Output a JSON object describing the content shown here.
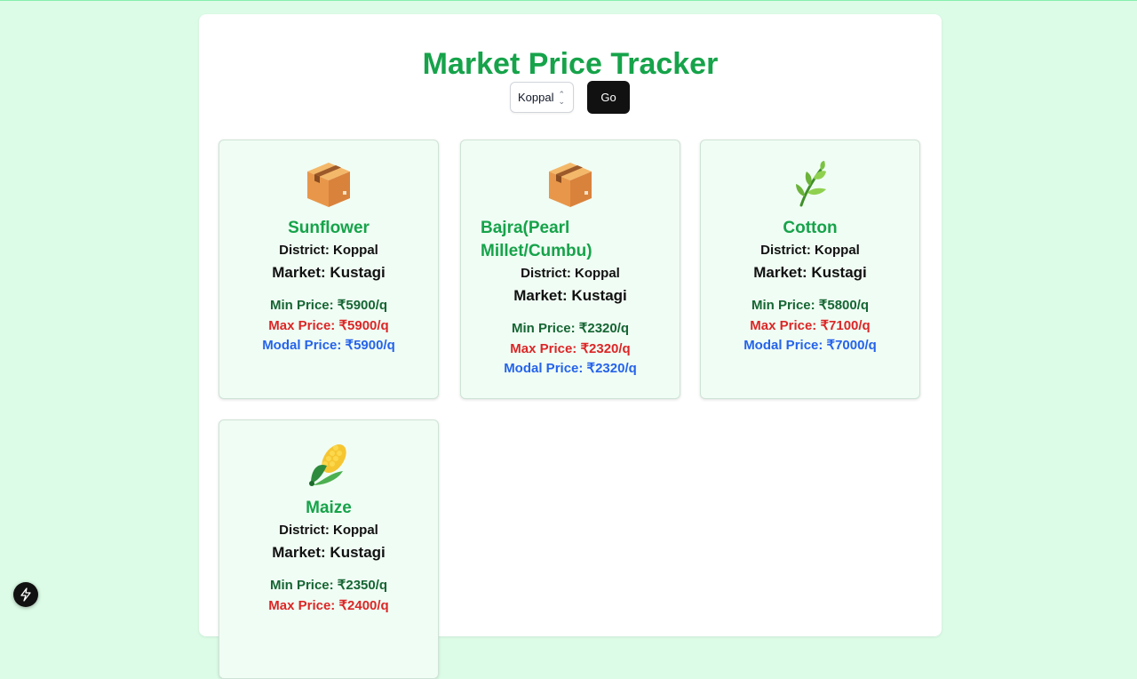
{
  "header": {
    "title": "Market Price Tracker"
  },
  "controls": {
    "district_select": "Koppal",
    "go_label": "Go"
  },
  "cards": [
    {
      "icon": "package-icon",
      "crop": "Sunflower",
      "district": "District: Koppal",
      "market": "Market: Kustagi",
      "min_price": "Min Price: ₹5900/q",
      "max_price": "Max Price: ₹5900/q",
      "modal_price": "Modal Price: ₹5900/q"
    },
    {
      "icon": "package-icon",
      "crop": "Bajra(Pearl Millet/Cumbu)",
      "district": "District: Koppal",
      "market": "Market: Kustagi",
      "min_price": "Min Price: ₹2320/q",
      "max_price": "Max Price: ₹2320/q",
      "modal_price": "Modal Price: ₹2320/q"
    },
    {
      "icon": "herb-icon",
      "crop": "Cotton",
      "district": "District: Koppal",
      "market": "Market: Kustagi",
      "min_price": "Min Price: ₹5800/q",
      "max_price": "Max Price: ₹7100/q",
      "modal_price": "Modal Price: ₹7000/q"
    },
    {
      "icon": "corn-icon",
      "crop": "Maize",
      "district": "District: Koppal",
      "market": "Market: Kustagi",
      "min_price": "Min Price: ₹2350/q",
      "max_price": "Max Price: ₹2400/q",
      "modal_price": ""
    }
  ],
  "colors": {
    "accent": "#16a34a",
    "min": "#166534",
    "max": "#dc2626",
    "modal": "#2563eb",
    "background": "#dcfce7",
    "card": "#f0fdf4"
  }
}
